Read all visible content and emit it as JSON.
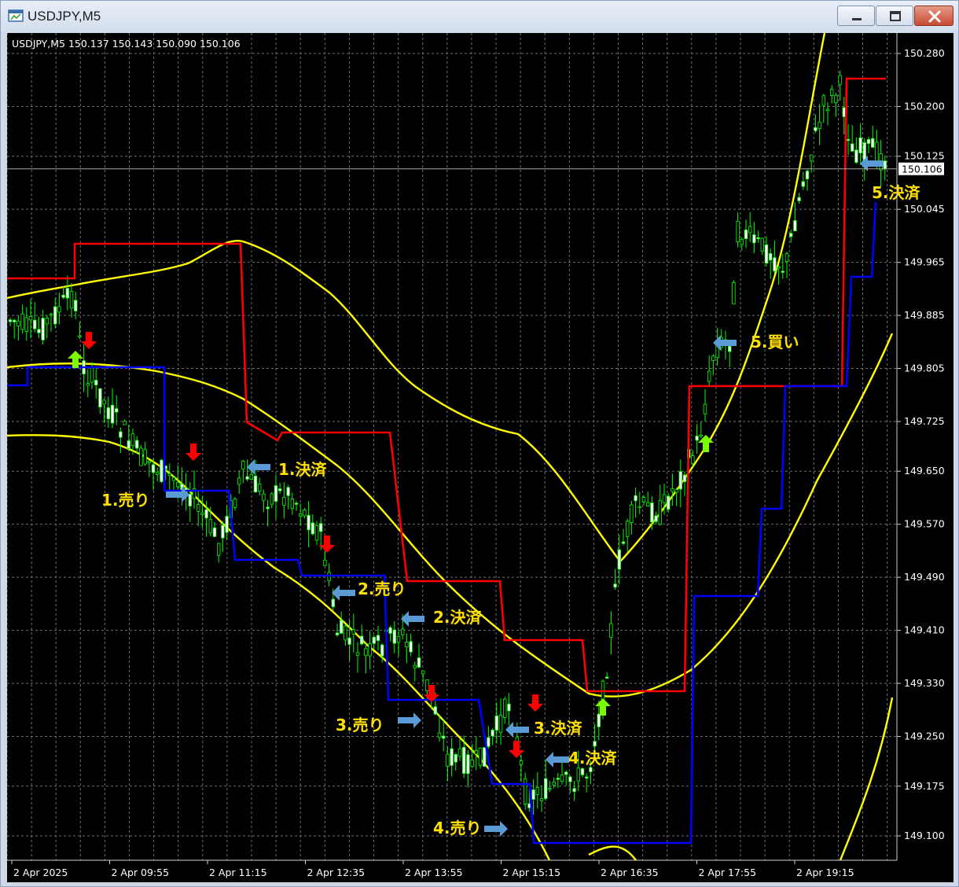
{
  "window": {
    "title": "USDJPY,M5",
    "icon": "chart-window-icon",
    "controls": [
      "minimize-icon",
      "maximize-icon",
      "close-icon"
    ]
  },
  "chart_data": {
    "type": "candlestick",
    "header": "USDJPY,M5  150.137 150.143 150.090 150.106",
    "symbol": "USDJPY,M5",
    "current_price": "150.106",
    "ylim": [
      149.06,
      150.31
    ],
    "y_ticks": [
      "150.280",
      "150.200",
      "150.125",
      "150.045",
      "149.965",
      "149.885",
      "149.805",
      "149.725",
      "149.650",
      "149.570",
      "149.490",
      "149.410",
      "149.330",
      "149.250",
      "149.175",
      "149.100"
    ],
    "x_ticks": [
      "2 Apr 2025",
      "2 Apr 09:55",
      "2 Apr 11:15",
      "2 Apr 12:35",
      "2 Apr 13:55",
      "2 Apr 15:15",
      "2 Apr 16:35",
      "2 Apr 17:55",
      "2 Apr 19:15"
    ],
    "grid": true,
    "colors": {
      "background": "#000000",
      "candle_up": "#00ff00",
      "candle_body_up": "#000000",
      "candle_body_down": "#ffffff",
      "bands": "#ffff00",
      "channel_high": "#ff0000",
      "channel_low": "#0000ff",
      "signal_sell": "#ff0000",
      "signal_buy": "#7cfc00",
      "exit_arrow": "#5b9bd5",
      "annotation_text": "#ffe000"
    },
    "annotations": [
      {
        "label": "1.売り",
        "kind": "sell"
      },
      {
        "label": "1.決済",
        "kind": "exit"
      },
      {
        "label": "2.売り",
        "kind": "sell"
      },
      {
        "label": "2.決済",
        "kind": "exit"
      },
      {
        "label": "3.売り",
        "kind": "sell"
      },
      {
        "label": "3.決済",
        "kind": "exit"
      },
      {
        "label": "4.売り",
        "kind": "sell"
      },
      {
        "label": "4.決済",
        "kind": "exit"
      },
      {
        "label": "5.買い",
        "kind": "buy"
      },
      {
        "label": "5.決済",
        "kind": "exit"
      }
    ]
  }
}
